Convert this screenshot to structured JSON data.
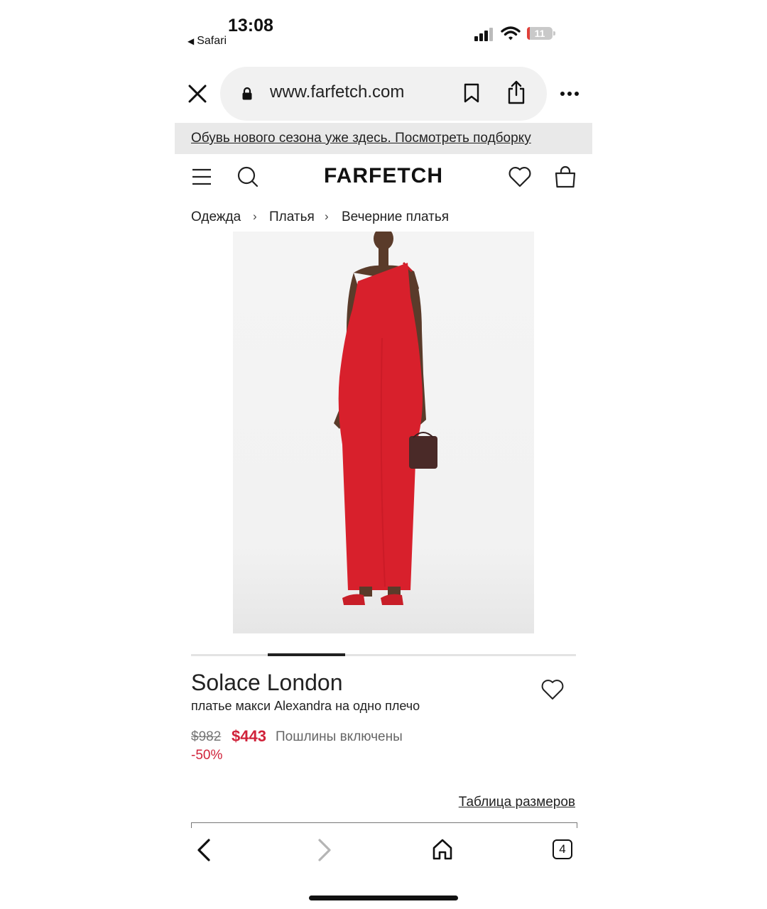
{
  "status_bar": {
    "time": "13:08",
    "back_app": "Safari",
    "battery": "11"
  },
  "browser": {
    "url": "www.farfetch.com"
  },
  "promo": {
    "text": "Обувь нового сезона уже здесь. Посмотреть подборку"
  },
  "header": {
    "logo": "FARFETCH"
  },
  "breadcrumb": {
    "items": [
      "Одежда",
      "Платья",
      "Вечерние платья"
    ],
    "separator": "›"
  },
  "gallery": {
    "active_index": 1,
    "count": 5
  },
  "product": {
    "brand": "Solace London",
    "description": "платье макси Alexandra на одно плечо",
    "old_price": "$982",
    "new_price": "$443",
    "duties": "Пошлины включены",
    "discount": "-50%",
    "size_chart": "Таблица размеров"
  },
  "toolbar": {
    "tabs_count": "4"
  },
  "colors": {
    "sale_red": "#d0223a",
    "dress_red": "#d8202c",
    "promo_bg": "#e9e9e9"
  }
}
